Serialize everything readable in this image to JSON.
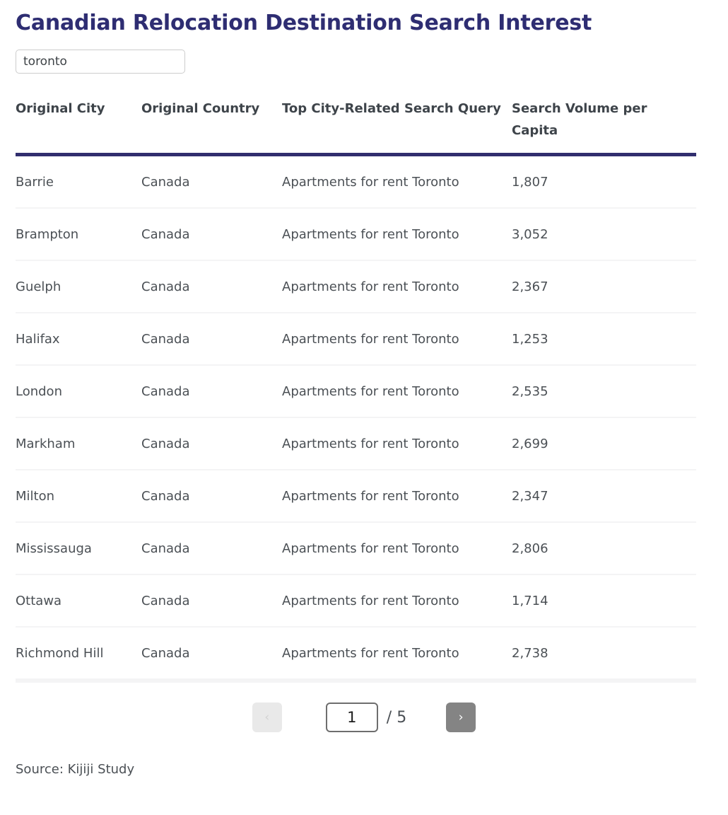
{
  "page": {
    "title": "Canadian Relocation Destination Search Interest",
    "accent_color": "#2e2d72",
    "header_rule_color": "#312e6e",
    "background_color": "#ffffff"
  },
  "search": {
    "value": "toronto",
    "placeholder": "toronto"
  },
  "table": {
    "columns": [
      {
        "key": "city",
        "label": "Original City"
      },
      {
        "key": "country",
        "label": "Original Country"
      },
      {
        "key": "query",
        "label": "Top City-Related Search Query"
      },
      {
        "key": "volume",
        "label": "Search Volume per Capita"
      }
    ],
    "rows": [
      {
        "city": "Barrie",
        "country": "Canada",
        "query": "Apartments for rent Toronto",
        "volume": "1,807"
      },
      {
        "city": "Brampton",
        "country": "Canada",
        "query": "Apartments for rent Toronto",
        "volume": "3,052"
      },
      {
        "city": "Guelph",
        "country": "Canada",
        "query": "Apartments for rent Toronto",
        "volume": "2,367"
      },
      {
        "city": "Halifax",
        "country": "Canada",
        "query": "Apartments for rent Toronto",
        "volume": "1,253"
      },
      {
        "city": "London",
        "country": "Canada",
        "query": "Apartments for rent Toronto",
        "volume": "2,535"
      },
      {
        "city": "Markham",
        "country": "Canada",
        "query": "Apartments for rent Toronto",
        "volume": "2,699"
      },
      {
        "city": "Milton",
        "country": "Canada",
        "query": "Apartments for rent Toronto",
        "volume": "2,347"
      },
      {
        "city": "Mississauga",
        "country": "Canada",
        "query": "Apartments for rent Toronto",
        "volume": "2,806"
      },
      {
        "city": "Ottawa",
        "country": "Canada",
        "query": "Apartments for rent Toronto",
        "volume": "1,714"
      },
      {
        "city": "Richmond Hill",
        "country": "Canada",
        "query": "Apartments for rent Toronto",
        "volume": "2,738"
      }
    ]
  },
  "pagination": {
    "prev_label": "‹",
    "next_label": "›",
    "current_page": "1",
    "total_label": "/ 5",
    "total_pages": 5,
    "prev_disabled": true
  },
  "footer": {
    "source": "Source: Kijiji Study"
  }
}
